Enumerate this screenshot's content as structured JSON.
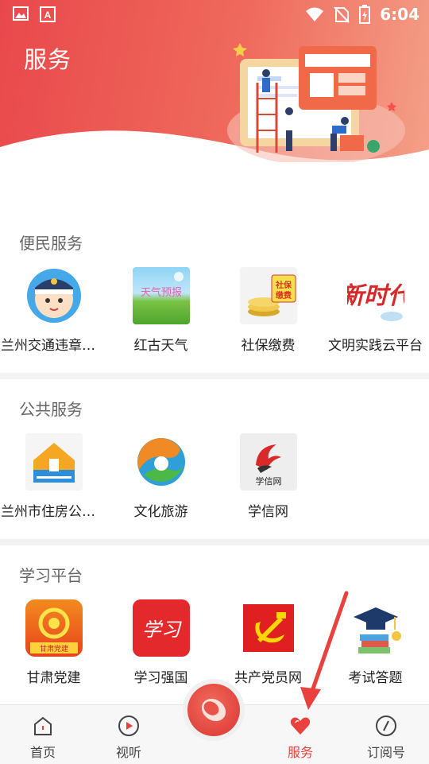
{
  "status_bar": {
    "time": "6:04"
  },
  "header": {
    "title": "服务"
  },
  "sections": [
    {
      "title": "便民服务",
      "items": [
        {
          "label": "兰州交通违章查询"
        },
        {
          "label": "红古天气",
          "img_text": "天气预报"
        },
        {
          "label": "社保缴费",
          "img_text": "社保缴费"
        },
        {
          "label": "文明实践云平台",
          "img_text": "新时代"
        }
      ]
    },
    {
      "title": "公共服务",
      "items": [
        {
          "label": "兰州市住房公积金"
        },
        {
          "label": "文化旅游"
        },
        {
          "label": "学信网",
          "img_text": "学信网"
        }
      ]
    },
    {
      "title": "学习平台",
      "items": [
        {
          "label": "甘肃党建",
          "img_text": "甘肃党建"
        },
        {
          "label": "学习强国",
          "img_text": "学习"
        },
        {
          "label": "共产党员网"
        },
        {
          "label": "考试答题"
        }
      ]
    }
  ],
  "tabs": [
    {
      "label": "首页",
      "icon": "home-icon"
    },
    {
      "label": "视听",
      "icon": "play-icon"
    },
    {
      "label": "服务",
      "icon": "heart-icon",
      "active": true
    },
    {
      "label": "订阅号",
      "icon": "compass-icon"
    }
  ],
  "colors": {
    "accent": "#e8413e",
    "header_start": "#e9484b",
    "header_end": "#f4a088"
  }
}
